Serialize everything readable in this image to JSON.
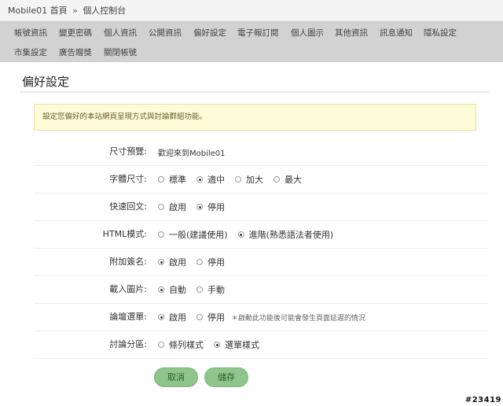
{
  "breadcrumb": {
    "home": "Mobile01 首頁",
    "separator": "»",
    "current": "個人控制台"
  },
  "nav": {
    "row1": [
      "帳號資訊",
      "變更密碼",
      "個人資訊",
      "公開資訊",
      "偏好設定",
      "電子報訂閱",
      "個人圖示",
      "其他資訊",
      "訊息通知",
      "隱私設定"
    ],
    "row2": [
      "市集設定",
      "廣告贈獎",
      "關閉帳號"
    ]
  },
  "panel": {
    "title": "偏好設定",
    "notice": "設定您偏好的本站網頁呈現方式與討論群組功能。"
  },
  "settings": {
    "preview": {
      "label": "尺寸預覽:",
      "value": "歡迎來到Mobile01"
    },
    "font_size": {
      "label": "字體尺寸:",
      "options": [
        "標準",
        "適中",
        "加大",
        "最大"
      ],
      "selected": "適中"
    },
    "quick_reply": {
      "label": "快速回文:",
      "options": [
        "啟用",
        "停用"
      ],
      "selected": "停用"
    },
    "html_mode": {
      "label": "HTML模式:",
      "options": [
        "一般(建議使用)",
        "進階(熟悉語法者使用)"
      ],
      "selected": "進階(熟悉語法者使用)"
    },
    "signature": {
      "label": "附加簽名:",
      "options": [
        "啟用",
        "停用"
      ],
      "selected": "啟用"
    },
    "load_images": {
      "label": "載入圖片:",
      "options": [
        "自動",
        "手動"
      ],
      "selected": "自動"
    },
    "forum_menu": {
      "label": "論壇選單:",
      "options": [
        "啟用",
        "停用"
      ],
      "selected": "啟用",
      "hint": "＊啟動此功能後可能會發生頁面延遲的情況"
    },
    "forum_category": {
      "label": "討論分區:",
      "options": [
        "條列樣式",
        "選單樣式"
      ],
      "selected": "選單樣式"
    }
  },
  "buttons": {
    "cancel": "取消",
    "save": "儲存"
  },
  "footer_tag": "#23419"
}
